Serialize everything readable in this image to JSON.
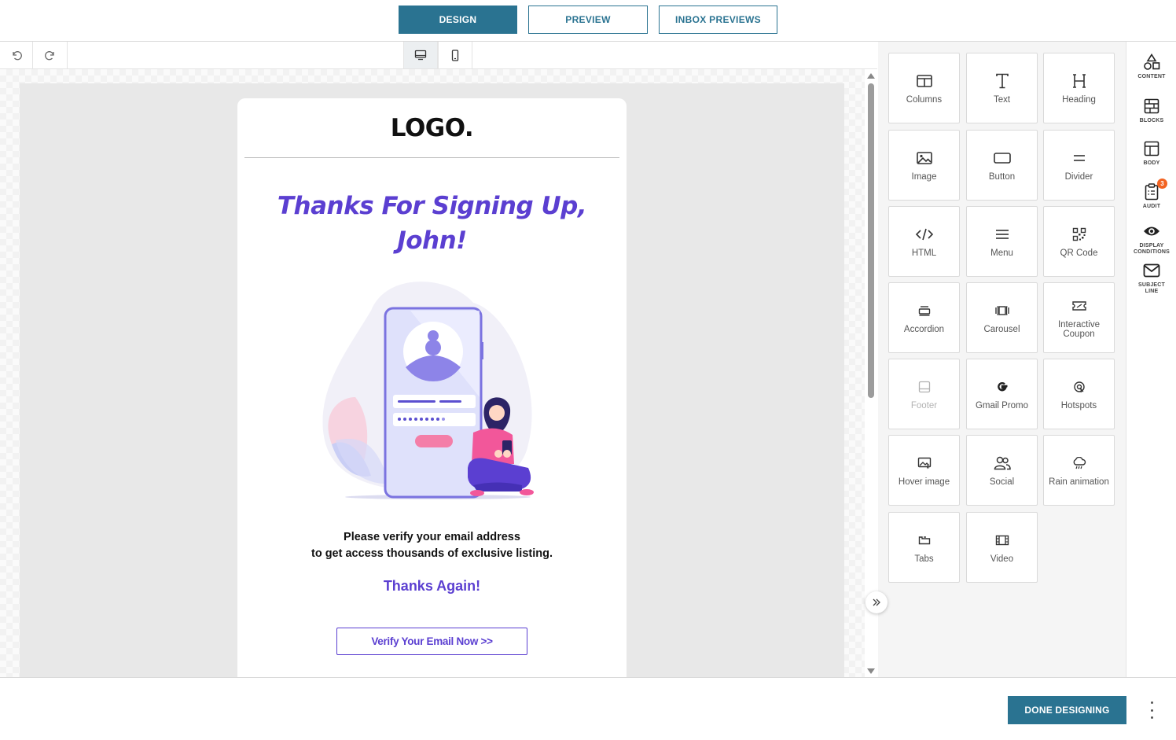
{
  "header": {
    "tabs": [
      {
        "label": "DESIGN",
        "active": true
      },
      {
        "label": "PREVIEW",
        "active": false
      },
      {
        "label": "INBOX PREVIEWS",
        "active": false
      }
    ]
  },
  "toolbar": {
    "undo_icon": "undo-icon",
    "redo_icon": "redo-icon",
    "devices": [
      {
        "icon": "desktop-icon",
        "active": true
      },
      {
        "icon": "mobile-icon",
        "active": false
      }
    ]
  },
  "email": {
    "logo": "LOGO.",
    "heading_line1": "Thanks For Signing Up,",
    "heading_line2": "John!",
    "body_line1": "Please verify your email address",
    "body_line2": "to get access thousands of exclusive listing.",
    "thanks": "Thanks Again!",
    "cta": "Verify Your Email Now >>"
  },
  "tools": [
    {
      "label": "Columns",
      "icon": "columns-icon"
    },
    {
      "label": "Text",
      "icon": "text-icon"
    },
    {
      "label": "Heading",
      "icon": "heading-icon"
    },
    {
      "label": "Image",
      "icon": "image-icon"
    },
    {
      "label": "Button",
      "icon": "button-icon"
    },
    {
      "label": "Divider",
      "icon": "divider-icon"
    },
    {
      "label": "HTML",
      "icon": "code-icon"
    },
    {
      "label": "Menu",
      "icon": "menu-icon"
    },
    {
      "label": "QR Code",
      "icon": "qr-code-icon"
    },
    {
      "label": "Accordion",
      "icon": "accordion-icon"
    },
    {
      "label": "Carousel",
      "icon": "carousel-icon"
    },
    {
      "label": "Interactive Coupon",
      "icon": "coupon-icon"
    },
    {
      "label": "Footer",
      "icon": "footer-icon",
      "disabled": true
    },
    {
      "label": "Gmail Promo",
      "icon": "google-icon"
    },
    {
      "label": "Hotspots",
      "icon": "hotspot-icon"
    },
    {
      "label": "Hover image",
      "icon": "hover-image-icon"
    },
    {
      "label": "Social",
      "icon": "social-icon"
    },
    {
      "label": "Rain animation",
      "icon": "rain-icon"
    },
    {
      "label": "Tabs",
      "icon": "tabs-icon"
    },
    {
      "label": "Video",
      "icon": "video-icon"
    }
  ],
  "rail": [
    {
      "label": "CONTENT",
      "icon": "shapes-icon"
    },
    {
      "label": "BLOCKS",
      "icon": "blocks-icon"
    },
    {
      "label": "BODY",
      "icon": "body-layout-icon"
    },
    {
      "label": "AUDIT",
      "icon": "audit-clipboard-icon",
      "badge": "3"
    },
    {
      "label": "DISPLAY CONDITIONS",
      "icon": "eye-icon"
    },
    {
      "label": "SUBJECT LINE",
      "icon": "envelope-icon"
    }
  ],
  "footer": {
    "done_label": "DONE DESIGNING"
  },
  "colors": {
    "accent": "#2a7391",
    "brand_purple": "#5b3fd1",
    "badge": "#f26322"
  }
}
